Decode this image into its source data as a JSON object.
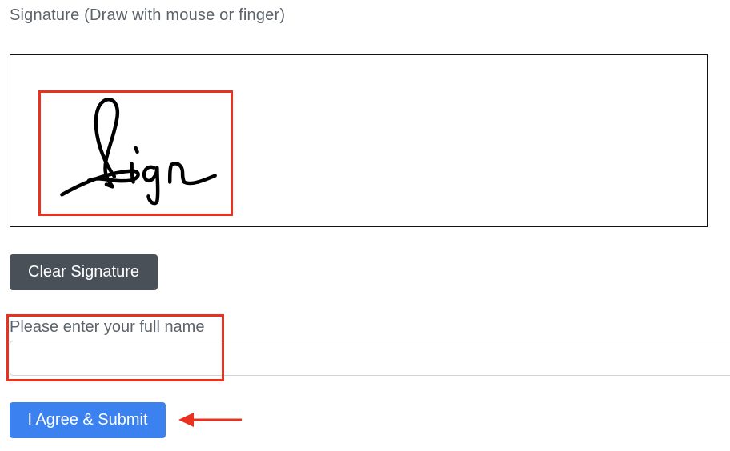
{
  "signature": {
    "label": "Signature (Draw with mouse or finger)",
    "clear_label": "Clear Signature"
  },
  "name_field": {
    "label": "Please enter your full name",
    "value": "",
    "placeholder": ""
  },
  "submit": {
    "label": "I Agree & Submit"
  },
  "annotations": {
    "highlight_color": "#e8321f",
    "arrow_color": "#e8321f"
  },
  "colors": {
    "clear_button": "#495057",
    "submit_button": "#3b82f0"
  }
}
